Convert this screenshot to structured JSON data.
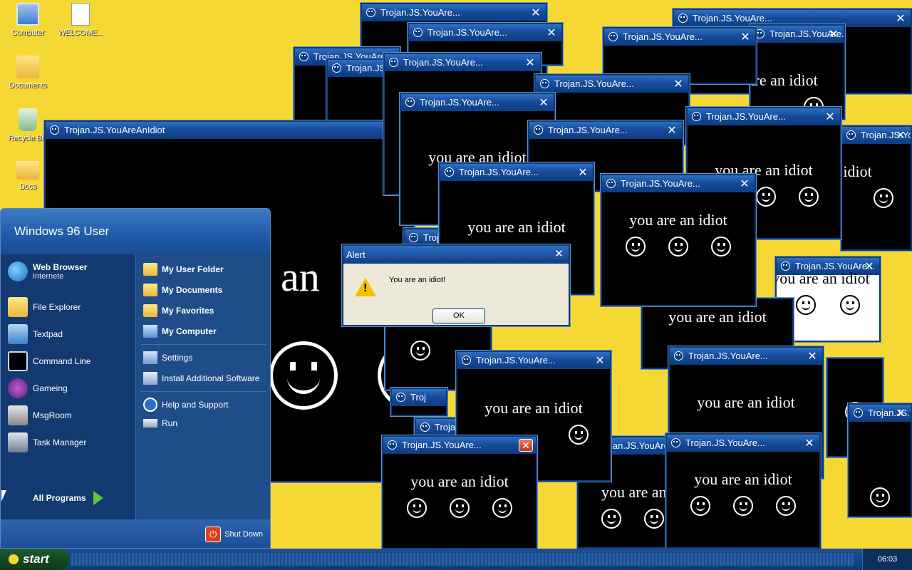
{
  "desktop": {
    "icons": [
      {
        "label": "Computer"
      },
      {
        "label": "WELCOME..."
      },
      {
        "label": "Documents"
      },
      {
        "label": "Recycle Bin"
      },
      {
        "label": "Docs"
      }
    ]
  },
  "popups": {
    "title_short": "Trojan.JS.YouAre...",
    "title_full": "Trojan.JS.YouAreAnIdiot",
    "title_stub": "Troj",
    "message": "you are an idiot",
    "big_message": "an",
    "close_glyph": "✕"
  },
  "alert": {
    "title": "Alert",
    "message": "You are an idiot!",
    "ok_label": "OK",
    "close_glyph": "✕",
    "warn_glyph": "!"
  },
  "start_menu": {
    "user_name": "Windows 96 User",
    "left_items": [
      {
        "label": "Web Browser",
        "sub": "Internete",
        "icon": "globe-icon"
      },
      {
        "label": "File Explorer",
        "icon": "file-explorer-icon"
      },
      {
        "label": "Textpad",
        "icon": "textpad-icon"
      },
      {
        "label": "Command Line",
        "icon": "terminal-icon"
      },
      {
        "label": "Gameing",
        "icon": "game-icon"
      },
      {
        "label": "MsgRoom",
        "icon": "msgroom-icon"
      },
      {
        "label": "Task Manager",
        "icon": "task-manager-icon"
      }
    ],
    "right_items": [
      {
        "label": "My User Folder",
        "icon": "folder-icon"
      },
      {
        "label": "My Documents",
        "icon": "documents-icon"
      },
      {
        "label": "My Favorites",
        "icon": "favorites-icon"
      },
      {
        "label": "My Computer",
        "icon": "computer-icon"
      },
      {
        "label": "Settings",
        "icon": "settings-icon"
      },
      {
        "label": "Install Additional Software",
        "icon": "install-icon"
      },
      {
        "label": "Help and Support",
        "icon": "help-icon"
      },
      {
        "label": "Run",
        "icon": "run-icon"
      }
    ],
    "all_programs": "All Programs",
    "shut_down": "Shut Down"
  },
  "taskbar": {
    "start_label": "start",
    "clock": "06:03"
  },
  "colors": {
    "desktop": "#f5d833",
    "titlebar": "#164c9c",
    "taskbar": "#1d4e92"
  }
}
